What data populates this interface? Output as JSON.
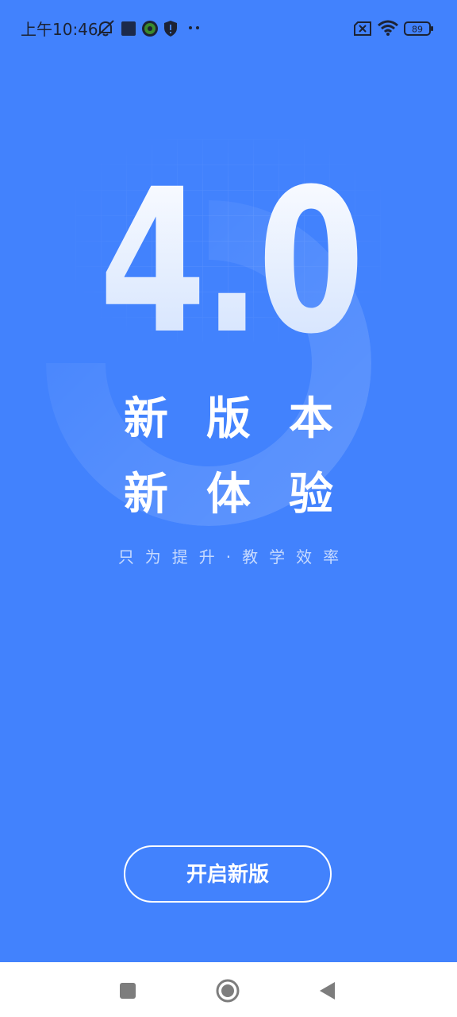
{
  "status_bar": {
    "time": "上午10:46",
    "battery_level": "89",
    "icons": [
      "notifications-off-icon",
      "app-square-icon",
      "app-badge-icon",
      "shield-icon",
      "more-dots-icon",
      "sim-error-icon",
      "wifi-icon",
      "battery-icon"
    ]
  },
  "hero": {
    "version": "4.0",
    "headline_line1": "新版本",
    "headline_line2": "新体验",
    "tagline": "只为提升·教学效率"
  },
  "actions": {
    "start_label": "开启新版"
  },
  "nav_bar": {
    "items": [
      "recent-apps-icon",
      "home-icon",
      "back-icon"
    ]
  },
  "colors": {
    "background": "#4282fd",
    "text": "#ffffff",
    "tagline": "#c7dafe",
    "nav_background": "#ffffff",
    "nav_icons": "#7d7d7d"
  }
}
